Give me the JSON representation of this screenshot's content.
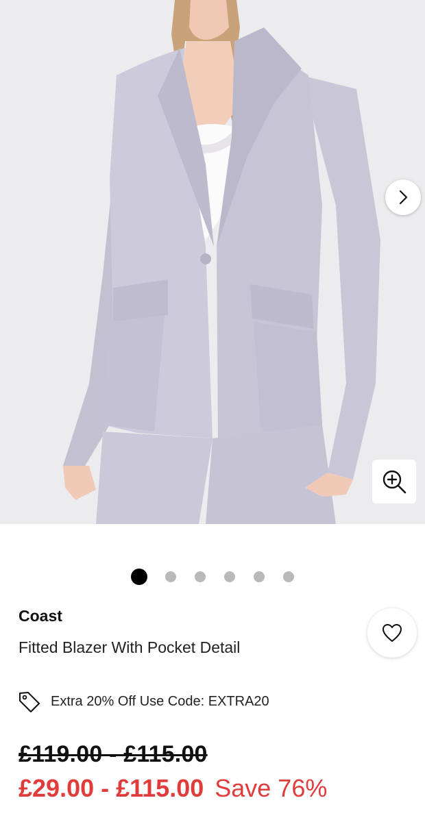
{
  "gallery": {
    "image_alt": "Lilac fitted blazer with pocket detail worn over white lace camisole",
    "slide_count": 6,
    "active_index": 0,
    "next_icon": "chevron-right-icon",
    "zoom_icon": "zoom-in-icon"
  },
  "product": {
    "brand": "Coast",
    "name": "Fitted Blazer With Pocket Detail",
    "wishlist_icon": "heart-outline-icon"
  },
  "promo": {
    "icon": "price-tag-icon",
    "text": "Extra 20% Off Use Code: EXTRA20"
  },
  "pricing": {
    "was": "£119.00 - £115.00",
    "now": "£29.00 - £115.00",
    "save": "Save 76%"
  },
  "colors": {
    "sale_red": "#e03c3c",
    "blazer_lilac": "#c8c5d6"
  }
}
